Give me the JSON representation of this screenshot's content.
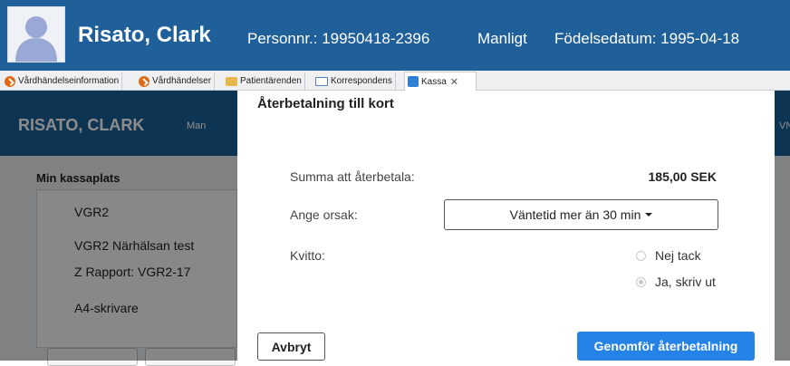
{
  "patient": {
    "name": "Risato, Clark",
    "personnr": "Personnr.: 19950418-2396",
    "gender": "Manligt",
    "dob": "Födelsedatum: 1995-04-18"
  },
  "tabs": [
    {
      "label": "Vårdhändelseinformation",
      "icon": "orange-check-icon"
    },
    {
      "label": "Vårdhändelser",
      "icon": "orange-check-icon"
    },
    {
      "label": "Patientärenden",
      "icon": "folder-icon"
    },
    {
      "label": "Korrespondens",
      "icon": "mail-icon"
    },
    {
      "label": "Kassa",
      "icon": "kassa-icon",
      "active": true
    }
  ],
  "background_app": {
    "name": "RISATO, CLARK",
    "gender": "Man",
    "right_fragment": "VN",
    "kassa_title": "Min kassaplats",
    "kassa_lines": [
      "VGR2",
      "VGR2 Närhälsan test",
      "Z Rapport: VGR2-17",
      "A4-skrivare"
    ]
  },
  "modal": {
    "title": "Återbetalning till kort",
    "amount_label": "Summa att återbetala:",
    "amount_value": "185,00 SEK",
    "reason_label": "Ange orsak:",
    "reason_selected": "Väntetid mer än 30 min",
    "receipt_label": "Kvitto:",
    "receipt_options": [
      {
        "label": "Nej tack",
        "checked": false
      },
      {
        "label": "Ja, skriv ut",
        "checked": true
      }
    ],
    "cancel_label": "Avbryt",
    "confirm_label": "Genomför återbetalning"
  },
  "colors": {
    "header_blue": "#1f5f9a",
    "primary_button": "#2583e8"
  }
}
